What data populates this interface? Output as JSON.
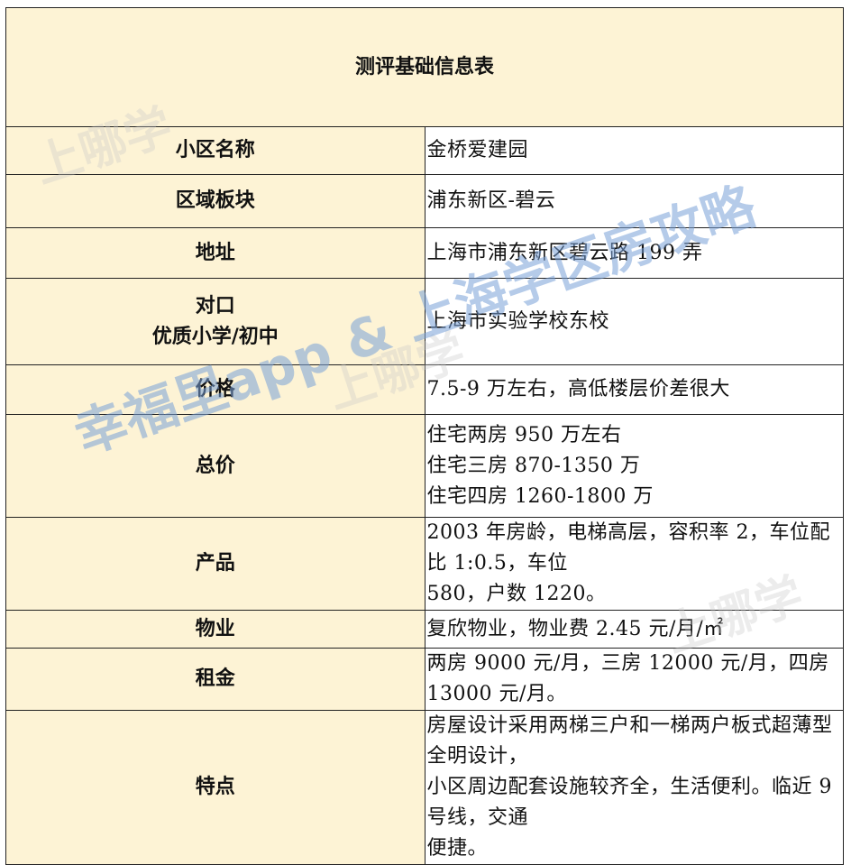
{
  "title": "测评基础信息表",
  "rows": [
    {
      "label": "小区名称",
      "value": [
        "金桥爱建园"
      ]
    },
    {
      "label": "区域板块",
      "value": [
        "浦东新区-碧云"
      ]
    },
    {
      "label": "地址",
      "value": [
        "上海市浦东新区碧云路 199 弄"
      ]
    },
    {
      "label": "对口",
      "label2": "优质小学/初中",
      "value": [
        "上海市实验学校东校"
      ]
    },
    {
      "label": "价格",
      "value": [
        "7.5-9 万左右，高低楼层价差很大"
      ]
    },
    {
      "label": "总价",
      "value": [
        "住宅两房 950 万左右",
        "住宅三房 870-1350 万",
        "住宅四房 1260-1800 万"
      ]
    },
    {
      "label": "产品",
      "value": [
        "2003 年房龄，电梯高层，容积率 2，车位配比 1:0.5，车位",
        "580，户数 1220。"
      ]
    },
    {
      "label": "物业",
      "value": [
        "复欣物业，物业费 2.45 元/月/㎡"
      ]
    },
    {
      "label": "租金",
      "value": [
        "两房 9000 元/月，三房 12000 元/月，四房 13000 元/月。"
      ]
    },
    {
      "label": "特点",
      "value": [
        "房屋设计采用两梯三户和一梯两户板式超薄型全明设计，",
        "小区周边配套设施较齐全，生活便利。临近 9 号线，交通",
        "便捷。"
      ]
    }
  ],
  "watermarks": {
    "main": "幸福里app & 上海学区房攻略",
    "small": "上哪学"
  }
}
